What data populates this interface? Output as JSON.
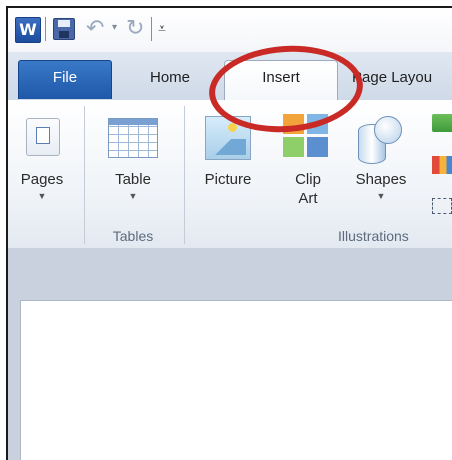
{
  "quick_access": {
    "app_icon": "W",
    "items": [
      "word-app-icon",
      "save-icon",
      "undo-icon",
      "redo-icon",
      "customize-qat-icon"
    ]
  },
  "tabs": {
    "file": "File",
    "home": "Home",
    "insert": "Insert",
    "page_layout": "Page Layou"
  },
  "ribbon": {
    "pages": {
      "label": "Pages",
      "icon": "pages-icon"
    },
    "table": {
      "label": "Table",
      "icon": "table-icon"
    },
    "picture": {
      "label": "Picture",
      "icon": "picture-icon"
    },
    "clip_art": {
      "label_line1": "Clip",
      "label_line2": "Art",
      "icon": "clip-art-icon"
    },
    "shapes": {
      "label": "Shapes",
      "icon": "shapes-icon"
    },
    "groups": {
      "tables": "Tables",
      "illustrations": "Illustrations"
    }
  },
  "colors": {
    "file_tab": "#2a66b8",
    "highlight": "#c92a26",
    "ribbon_bg": "#eef2f7"
  }
}
